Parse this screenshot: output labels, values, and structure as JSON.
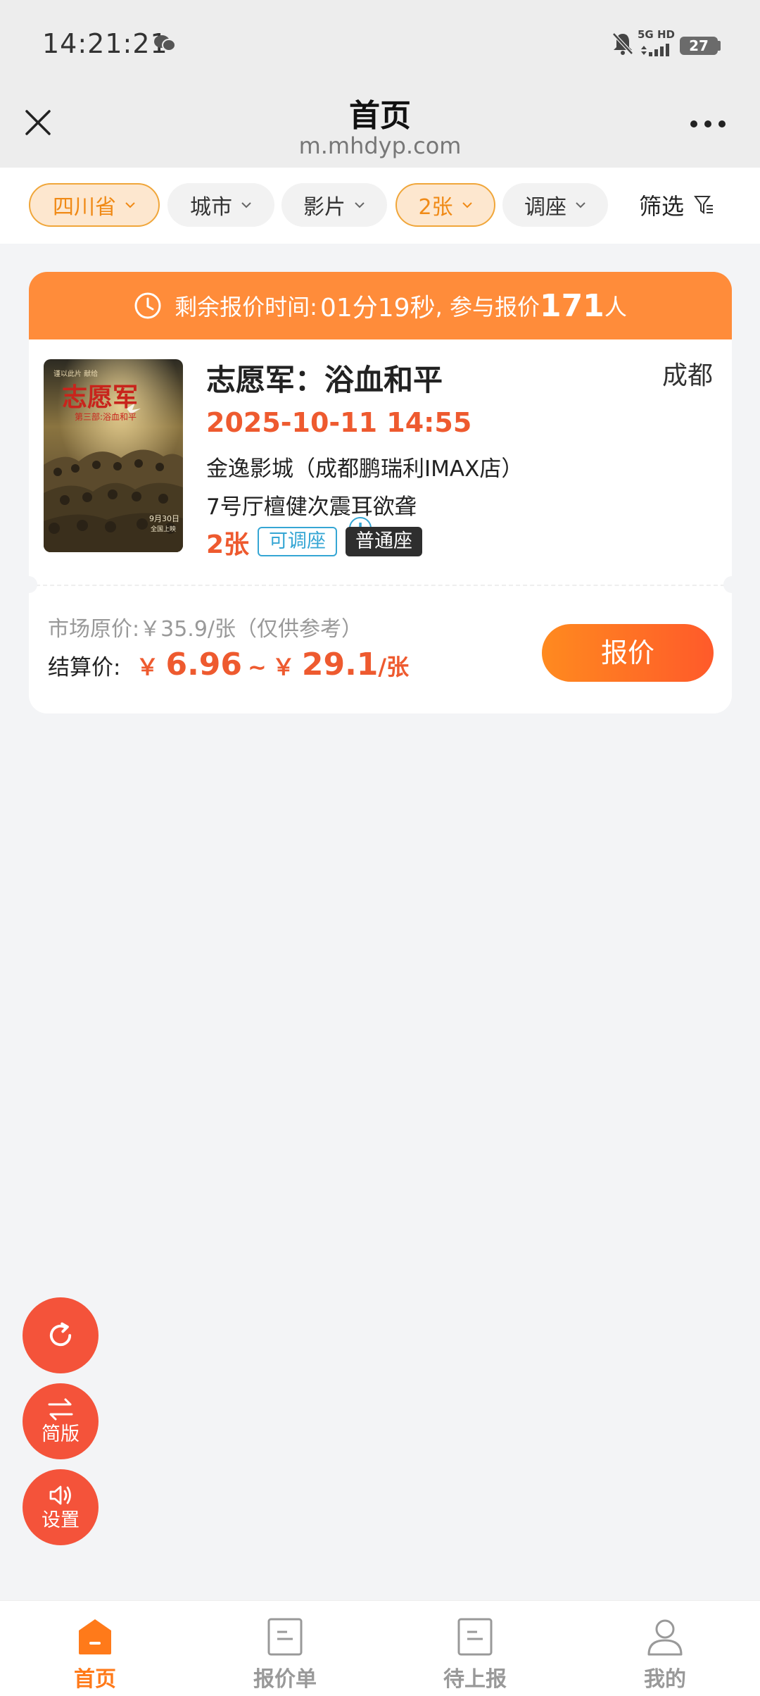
{
  "status_bar": {
    "time": "14:21:21",
    "network": "5G HD",
    "battery": "27"
  },
  "nav": {
    "title": "首页",
    "url": "m.mhdyp.com"
  },
  "filters": {
    "chips": [
      {
        "label": "四川省",
        "active": true
      },
      {
        "label": "城市",
        "active": false
      },
      {
        "label": "影片",
        "active": false
      },
      {
        "label": "2张",
        "active": true
      },
      {
        "label": "调座",
        "active": false
      }
    ],
    "filter_label": "筛选"
  },
  "listing": {
    "header_prefix": "剩余报价时间:",
    "countdown": "01分19秒",
    "participants_prefix": ", 参与报价",
    "participants": "171",
    "participants_suffix": "人",
    "movie_title": "志愿军：浴血和平",
    "city": "成都",
    "showtime": "2025-10-11 14:55",
    "cinema": "金逸影城（成都鹏瑞利IMAX店）",
    "hall": "7号厅檀健次震耳欲聋",
    "ticket_count": "2张",
    "tag_adjustable": "可调座",
    "tag_seat": "普通座",
    "market_price": "市场原价:￥35.9/张（仅供参考）",
    "settle_label": "结算价:",
    "currency": "￥",
    "price_min": "6.96",
    "price_max": "29.1",
    "price_unit": "/张",
    "quote_button": "报价"
  },
  "poster": {
    "line1": "谨以此片  献给",
    "title": "志愿军",
    "subtitle": "第三部:浴血和平",
    "date": "9月30日",
    "tagline": "全国上映"
  },
  "fab": {
    "simple_label": "简版",
    "settings_label": "设置"
  },
  "tabs": [
    {
      "label": "首页",
      "icon": "home-icon",
      "active": true
    },
    {
      "label": "报价单",
      "icon": "document-icon",
      "active": false
    },
    {
      "label": "待上报",
      "icon": "document-icon",
      "active": false
    },
    {
      "label": "我的",
      "icon": "user-icon",
      "active": false
    }
  ],
  "colors": {
    "accent": "#ff8c3a",
    "price": "#ee5a2f",
    "fab": "#f4533a",
    "tag_blue": "#35a6d4"
  }
}
